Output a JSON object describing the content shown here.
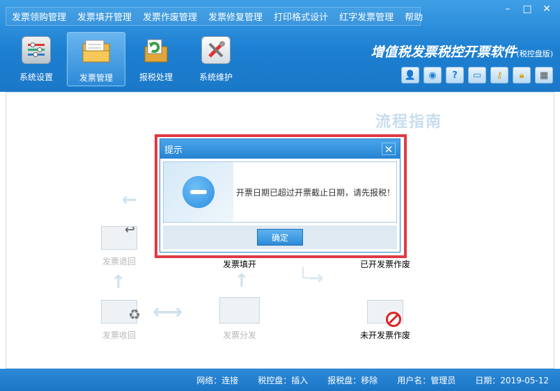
{
  "menu": [
    "发票领购管理",
    "发票填开管理",
    "发票作废管理",
    "发票修复管理",
    "打印格式设计",
    "红字发票管理",
    "帮助"
  ],
  "window_controls": {
    "minimize": "–",
    "maximize": "□",
    "close": "✕"
  },
  "toolbar": [
    {
      "label": "系统设置",
      "icon": "settings-panel-icon"
    },
    {
      "label": "发票管理",
      "icon": "invoice-folder-icon"
    },
    {
      "label": "报税处理",
      "icon": "tax-report-icon"
    },
    {
      "label": "系统维护",
      "icon": "tools-icon"
    }
  ],
  "app_title": {
    "main": "增值税发票税控开票软件",
    "suffix": "(税控盘版)"
  },
  "quick_tools": [
    "user-icon",
    "globe-icon",
    "help-icon",
    "window-icon",
    "key-icon",
    "lock-icon",
    "calculator-icon"
  ],
  "guide": {
    "title": "流程指南",
    "steps": {
      "return": "发票退回",
      "fill": "发票填开",
      "void_issued": "已开发票作废",
      "recover": "发票收回",
      "distribute": "发票分发",
      "void_unissued": "未开发票作废"
    }
  },
  "dialog": {
    "title": "提示",
    "close": "✕",
    "message": "开票日期已超过开票截止日期，请先报税！",
    "ok_label": "确定"
  },
  "status": {
    "network": "网络：连接",
    "tax_disk": "税控盘：插入",
    "report_disk": "报税盘：移除",
    "user": "用户名：管理员",
    "date": "日期：2019-05-12"
  },
  "colors": {
    "header": "#1d7fd1",
    "dialog_highlight": "#e03a45",
    "status": "#2d8ad8"
  }
}
